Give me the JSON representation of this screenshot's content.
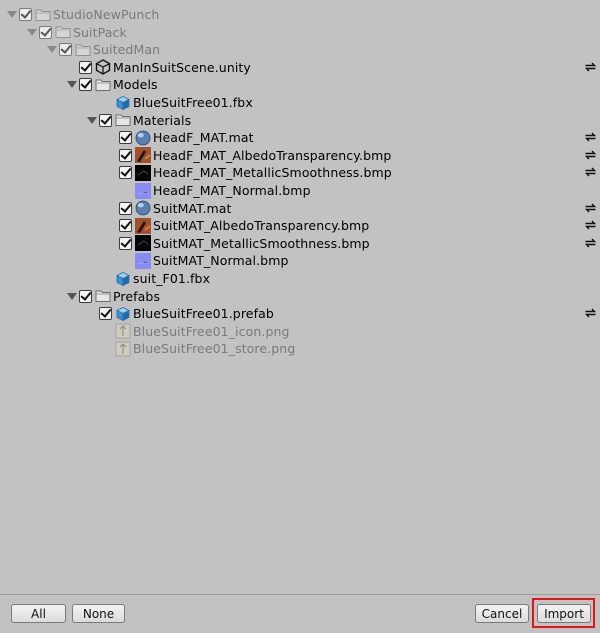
{
  "tree": [
    {
      "label": "StudioNewPunch",
      "level": 0,
      "foldout": true,
      "checked": true,
      "icon": "folder-icon",
      "dim": true,
      "refresh": false
    },
    {
      "label": "SuitPack",
      "level": 1,
      "foldout": true,
      "checked": true,
      "icon": "folder-icon",
      "dim": true,
      "refresh": false
    },
    {
      "label": "SuitedMan",
      "level": 2,
      "foldout": true,
      "checked": true,
      "icon": "folder-icon",
      "dim": true,
      "refresh": false
    },
    {
      "label": "ManInSuitScene.unity",
      "level": 3,
      "foldout": false,
      "checked": true,
      "icon": "unity-scene-icon",
      "dim": false,
      "refresh": true
    },
    {
      "label": "Models",
      "level": 3,
      "foldout": true,
      "checked": true,
      "icon": "folder-icon",
      "dim": false,
      "refresh": false
    },
    {
      "label": "BlueSuitFree01.fbx",
      "level": 4,
      "foldout": false,
      "checked": null,
      "icon": "model-icon",
      "dim": false,
      "refresh": false
    },
    {
      "label": "Materials",
      "level": 4,
      "foldout": true,
      "checked": true,
      "icon": "folder-icon",
      "dim": false,
      "refresh": false
    },
    {
      "label": "HeadF_MAT.mat",
      "level": 5,
      "foldout": false,
      "checked": true,
      "icon": "material-sphere-icon",
      "dim": false,
      "refresh": true
    },
    {
      "label": "HeadF_MAT_AlbedoTransparency.bmp",
      "level": 5,
      "foldout": false,
      "checked": true,
      "icon": "albedo-texture-icon",
      "dim": false,
      "refresh": true
    },
    {
      "label": "HeadF_MAT_MetallicSmoothness.bmp",
      "level": 5,
      "foldout": false,
      "checked": true,
      "icon": "metallic-texture-icon",
      "dim": false,
      "refresh": true
    },
    {
      "label": "HeadF_MAT_Normal.bmp",
      "level": 5,
      "foldout": false,
      "checked": null,
      "icon": "normal-texture-icon",
      "dim": false,
      "refresh": false
    },
    {
      "label": "SuitMAT.mat",
      "level": 5,
      "foldout": false,
      "checked": true,
      "icon": "material-sphere-icon",
      "dim": false,
      "refresh": true
    },
    {
      "label": "SuitMAT_AlbedoTransparency.bmp",
      "level": 5,
      "foldout": false,
      "checked": true,
      "icon": "albedo-texture-icon",
      "dim": false,
      "refresh": true
    },
    {
      "label": "SuitMAT_MetallicSmoothness.bmp",
      "level": 5,
      "foldout": false,
      "checked": true,
      "icon": "metallic-texture-icon",
      "dim": false,
      "refresh": true
    },
    {
      "label": "SuitMAT_Normal.bmp",
      "level": 5,
      "foldout": false,
      "checked": null,
      "icon": "normal-texture-icon",
      "dim": false,
      "refresh": false
    },
    {
      "label": "suit_F01.fbx",
      "level": 4,
      "foldout": false,
      "checked": null,
      "icon": "model-icon",
      "dim": false,
      "refresh": false
    },
    {
      "label": "Prefabs",
      "level": 3,
      "foldout": true,
      "checked": true,
      "icon": "folder-icon",
      "dim": false,
      "refresh": false
    },
    {
      "label": "BlueSuitFree01.prefab",
      "level": 4,
      "foldout": false,
      "checked": true,
      "icon": "prefab-icon",
      "dim": false,
      "refresh": true
    },
    {
      "label": "BlueSuitFree01_icon.png",
      "level": 4,
      "foldout": false,
      "checked": null,
      "icon": "image-icon",
      "dim": true,
      "refresh": false
    },
    {
      "label": "BlueSuitFree01_store.png",
      "level": 4,
      "foldout": false,
      "checked": null,
      "icon": "image-icon",
      "dim": true,
      "refresh": false
    }
  ],
  "buttons": {
    "all": "All",
    "none": "None",
    "cancel": "Cancel",
    "import": "Import"
  },
  "colors": {
    "background": "#c2c2c2",
    "highlight": "#e0141b"
  }
}
